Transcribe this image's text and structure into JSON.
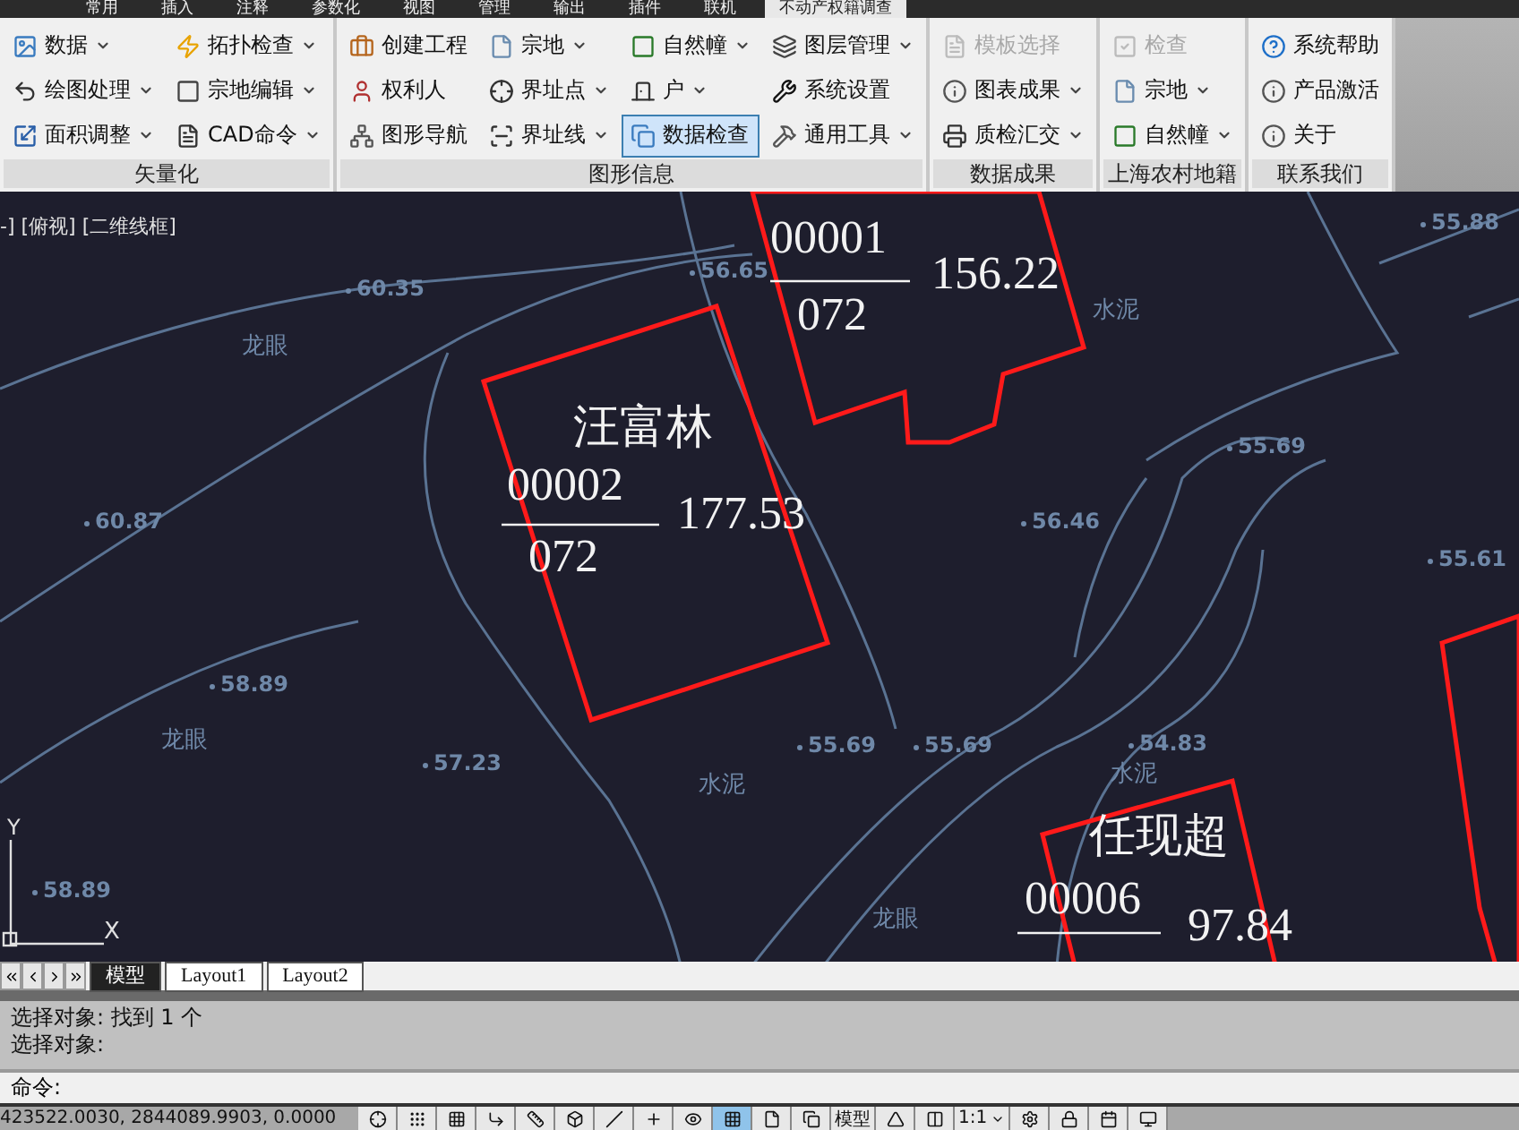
{
  "app_tabs": [
    {
      "label": "常用",
      "selected": false
    },
    {
      "label": "插入",
      "selected": false
    },
    {
      "label": "注释",
      "selected": false
    },
    {
      "label": "参数化",
      "selected": false
    },
    {
      "label": "视图",
      "selected": false
    },
    {
      "label": "管理",
      "selected": false
    },
    {
      "label": "输出",
      "selected": false
    },
    {
      "label": "插件",
      "selected": false
    },
    {
      "label": "联机",
      "selected": false
    },
    {
      "label": "不动产权籍调查",
      "selected": true
    }
  ],
  "ribbon": [
    {
      "title": "矢量化",
      "columns": [
        [
          {
            "label": "数据",
            "dropdown": true,
            "disabled": false,
            "selected": false
          },
          {
            "label": "绘图处理",
            "dropdown": true,
            "disabled": false,
            "selected": false
          },
          {
            "label": "面积调整",
            "dropdown": true,
            "disabled": false,
            "selected": false
          }
        ],
        [
          {
            "label": "拓扑检查",
            "dropdown": true,
            "disabled": false,
            "selected": false
          },
          {
            "label": "宗地编辑",
            "dropdown": true,
            "disabled": false,
            "selected": false
          },
          {
            "label": "CAD命令",
            "dropdown": true,
            "disabled": false,
            "selected": false
          }
        ]
      ]
    },
    {
      "title": "图形信息",
      "columns": [
        [
          {
            "label": "创建工程",
            "dropdown": false,
            "disabled": false,
            "selected": false
          },
          {
            "label": "权利人",
            "dropdown": false,
            "disabled": false,
            "selected": false
          },
          {
            "label": "图形导航",
            "dropdown": false,
            "disabled": false,
            "selected": false
          }
        ],
        [
          {
            "label": "宗地",
            "dropdown": true,
            "disabled": false,
            "selected": false
          },
          {
            "label": "界址点",
            "dropdown": true,
            "disabled": false,
            "selected": false
          },
          {
            "label": "界址线",
            "dropdown": true,
            "disabled": false,
            "selected": false
          }
        ],
        [
          {
            "label": "自然幢",
            "dropdown": true,
            "disabled": false,
            "selected": false
          },
          {
            "label": "户",
            "dropdown": true,
            "disabled": false,
            "selected": false
          },
          {
            "label": "数据检查",
            "dropdown": false,
            "disabled": false,
            "selected": true
          }
        ],
        [
          {
            "label": "图层管理",
            "dropdown": true,
            "disabled": false,
            "selected": false
          },
          {
            "label": "系统设置",
            "dropdown": false,
            "disabled": false,
            "selected": false
          },
          {
            "label": "通用工具",
            "dropdown": true,
            "disabled": false,
            "selected": false
          }
        ]
      ]
    },
    {
      "title": "数据成果",
      "columns": [
        [
          {
            "label": "模板选择",
            "dropdown": false,
            "disabled": true,
            "selected": false
          },
          {
            "label": "图表成果",
            "dropdown": true,
            "disabled": false,
            "selected": false
          },
          {
            "label": "质检汇交",
            "dropdown": true,
            "disabled": false,
            "selected": false
          }
        ]
      ]
    },
    {
      "title": "上海农村地籍",
      "columns": [
        [
          {
            "label": "检查",
            "dropdown": false,
            "disabled": true,
            "selected": false
          },
          {
            "label": "宗地",
            "dropdown": true,
            "disabled": false,
            "selected": false
          },
          {
            "label": "自然幢",
            "dropdown": true,
            "disabled": false,
            "selected": false
          }
        ]
      ]
    },
    {
      "title": "联系我们",
      "columns": [
        [
          {
            "label": "系统帮助",
            "dropdown": false,
            "disabled": false,
            "selected": false
          },
          {
            "label": "产品激活",
            "dropdown": false,
            "disabled": false,
            "selected": false
          },
          {
            "label": "关于",
            "dropdown": false,
            "disabled": false,
            "selected": false
          }
        ]
      ]
    }
  ],
  "viewport_label": "-] [俯视] [二维线框]",
  "parcels": [
    {
      "code": "00001",
      "sub": "072",
      "area": "156.22"
    },
    {
      "owner": "汪富林",
      "code": "00002",
      "sub": "072",
      "area": "177.53"
    },
    {
      "owner": "任现超",
      "code": "00006",
      "area": "97.84"
    }
  ],
  "elevations": [
    "60.35",
    "56.65",
    "55.88",
    "60.87",
    "55.69",
    "56.46",
    "55.61",
    "58.89",
    "57.23",
    "55.69",
    "55.69",
    "54.83",
    "58.89"
  ],
  "land_labels": [
    "龙眼",
    "龙眼",
    "龙眼",
    "水泥",
    "水泥",
    "水泥"
  ],
  "ucs": {
    "y_label": "Y",
    "x_label": "X"
  },
  "layout_tabs": [
    {
      "label": "模型",
      "selected": true
    },
    {
      "label": "Layout1",
      "selected": false
    },
    {
      "label": "Layout2",
      "selected": false
    }
  ],
  "command_history": [
    "选择对象: 找到 1 个",
    "选择对象:"
  ],
  "command_prompt": "命令:",
  "status_bar": {
    "coordinates": "423522.0030, 2844089.9903, 0.0000",
    "model_button": "模型",
    "scale": "1:1",
    "toggles": [
      {
        "on": false
      },
      {
        "on": false
      },
      {
        "on": false
      },
      {
        "on": false
      },
      {
        "on": false
      },
      {
        "on": false
      },
      {
        "on": false
      },
      {
        "on": false
      },
      {
        "on": false
      },
      {
        "on": true
      },
      {
        "on": false
      },
      {
        "on": false
      }
    ]
  }
}
